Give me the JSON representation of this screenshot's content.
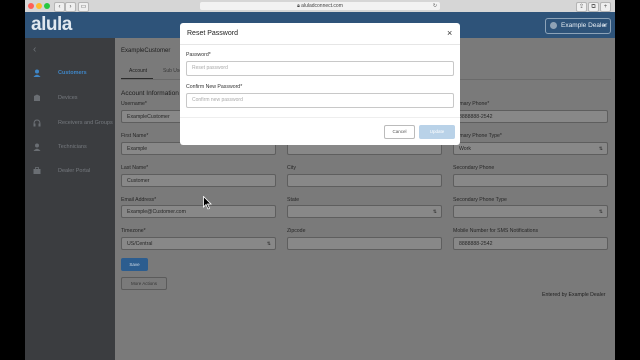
{
  "browser": {
    "url": "aluladconnect.com"
  },
  "header": {
    "logo": "alula",
    "user": "Example Dealer"
  },
  "sidebar": {
    "items": [
      {
        "label": "Customers",
        "icon": "user-icon",
        "active": true
      },
      {
        "label": "Devices",
        "icon": "device-icon",
        "active": false
      },
      {
        "label": "Receivers and Groups",
        "icon": "headset-icon",
        "active": false
      },
      {
        "label": "Technicians",
        "icon": "technician-icon",
        "active": false
      },
      {
        "label": "Dealer Portal",
        "icon": "portal-icon",
        "active": false
      }
    ]
  },
  "page": {
    "customer_name": "ExampleCustomer",
    "tabs": [
      "Account",
      "Sub User"
    ],
    "section_title": "Account Information",
    "footer_note": "Entered by Example Dealer"
  },
  "form": {
    "username": {
      "label": "Username*",
      "value": "ExampleCustomer"
    },
    "first_name": {
      "label": "First Name*",
      "value": "Example"
    },
    "last_name": {
      "label": "Last Name*",
      "value": "Customer"
    },
    "email": {
      "label": "Email Address*",
      "value": "Example@Customer.com"
    },
    "timezone": {
      "label": "Timezone*",
      "value": "US/Central"
    },
    "city": {
      "label": "City",
      "value": ""
    },
    "state": {
      "label": "State",
      "value": ""
    },
    "zipcode": {
      "label": "Zipcode",
      "value": ""
    },
    "primary_phone": {
      "label": "Primary Phone*",
      "value": "8888888-2542"
    },
    "primary_phone_type": {
      "label": "Primary Phone Type*",
      "value": "Work"
    },
    "secondary_phone": {
      "label": "Secondary Phone",
      "value": ""
    },
    "secondary_phone_type": {
      "label": "Secondary Phone Type",
      "value": ""
    },
    "sms_number": {
      "label": "Mobile Number for SMS Notifications",
      "value": "8888888-2542"
    },
    "save_label": "Save",
    "more_actions_label": "More Actions"
  },
  "modal": {
    "title": "Reset Password",
    "password_label": "Password*",
    "password_placeholder": "Reset password",
    "confirm_label": "Confirm New Password*",
    "confirm_placeholder": "Confirm new password",
    "cancel_label": "Cancel",
    "submit_label": "Update"
  },
  "colors": {
    "header": "#2e5379",
    "accent": "#3f86c6",
    "primary_button": "#2c5d8f"
  }
}
